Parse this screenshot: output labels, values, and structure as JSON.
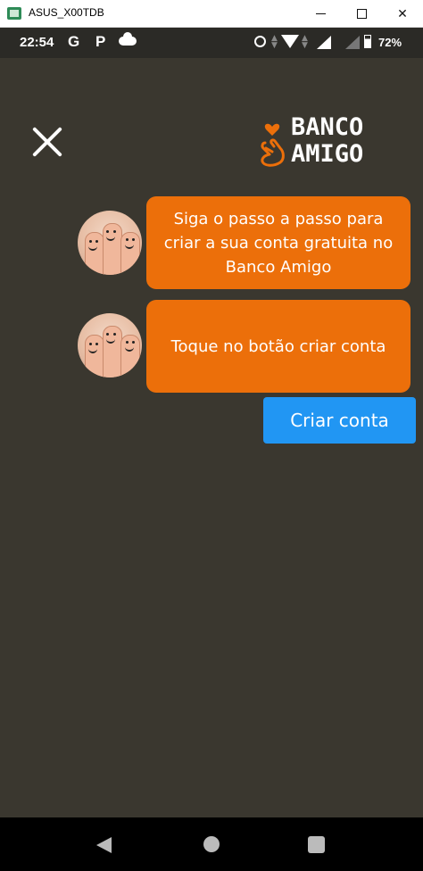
{
  "window": {
    "title": "ASUS_X00TDB"
  },
  "status_bar": {
    "time": "22:54",
    "icons": [
      "g-icon",
      "p-icon",
      "cloud-icon",
      "alarm-icon",
      "wifi-icon",
      "signal-icon",
      "battery-icon"
    ],
    "g_label": "G",
    "p_label": "P",
    "battery_percent": "72%"
  },
  "header": {
    "close_icon": "close-icon",
    "logo_line1": "BANCO",
    "logo_line2": "AMIGO",
    "logo_color": "#ec6f0a"
  },
  "chat": {
    "messages": [
      {
        "text": "Siga o passo a passo para criar a sua conta gratuita no Banco Amigo"
      },
      {
        "text": "Toque no botão criar conta"
      }
    ],
    "bubble_color": "#ec6f0a"
  },
  "cta": {
    "label": "Criar conta",
    "color": "#2196f3"
  },
  "nav_bar": {
    "icons": [
      "back-icon",
      "home-icon",
      "recents-icon"
    ]
  },
  "colors": {
    "background": "#3a372f",
    "status_bar": "#2b2a26"
  }
}
